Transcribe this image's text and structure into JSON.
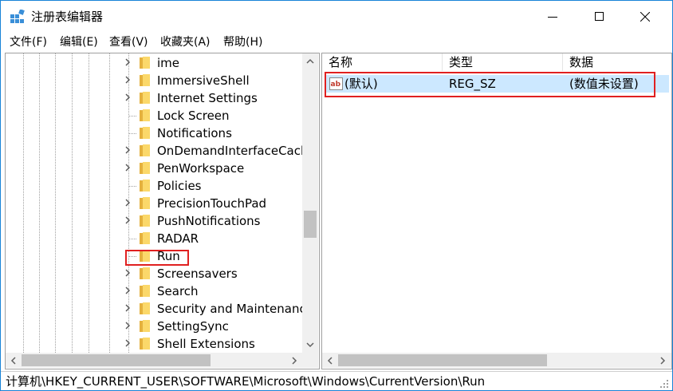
{
  "window": {
    "title": "注册表编辑器",
    "accent": "#1883d7",
    "highlight_color": "#e02020",
    "selection_color": "#cce8ff"
  },
  "menu": [
    {
      "label": "文件(F)"
    },
    {
      "label": "编辑(E)"
    },
    {
      "label": "查看(V)"
    },
    {
      "label": "收藏夹(A)"
    },
    {
      "label": "帮助(H)"
    }
  ],
  "tree": {
    "items": [
      {
        "label": "ime",
        "expandable": true,
        "icon": "folder-icon"
      },
      {
        "label": "ImmersiveShell",
        "expandable": true,
        "icon": "folder-icon"
      },
      {
        "label": "Internet Settings",
        "expandable": true,
        "icon": "folder-icon"
      },
      {
        "label": "Lock Screen",
        "expandable": false,
        "icon": "folder-icon"
      },
      {
        "label": "Notifications",
        "expandable": false,
        "icon": "folder-icon"
      },
      {
        "label": "OnDemandInterfaceCach",
        "expandable": true,
        "icon": "folder-icon"
      },
      {
        "label": "PenWorkspace",
        "expandable": true,
        "icon": "folder-icon"
      },
      {
        "label": "Policies",
        "expandable": false,
        "icon": "folder-icon"
      },
      {
        "label": "PrecisionTouchPad",
        "expandable": true,
        "icon": "folder-icon"
      },
      {
        "label": "PushNotifications",
        "expandable": true,
        "icon": "folder-icon"
      },
      {
        "label": "RADAR",
        "expandable": false,
        "icon": "folder-icon"
      },
      {
        "label": "Run",
        "expandable": false,
        "icon": "folder-icon",
        "highlighted": true
      },
      {
        "label": "Screensavers",
        "expandable": true,
        "icon": "folder-icon"
      },
      {
        "label": "Search",
        "expandable": true,
        "icon": "folder-icon"
      },
      {
        "label": "Security and Maintenance",
        "expandable": true,
        "icon": "folder-icon"
      },
      {
        "label": "SettingSync",
        "expandable": true,
        "icon": "folder-icon"
      },
      {
        "label": "Shell Extensions",
        "expandable": true,
        "icon": "folder-icon"
      }
    ]
  },
  "list": {
    "columns": {
      "name": "名称",
      "type": "类型",
      "data": "数据"
    },
    "rows": [
      {
        "icon": "string-value-icon",
        "name": "(默认)",
        "type": "REG_SZ",
        "data": "(数值未设置)"
      }
    ]
  },
  "status": {
    "path": "计算机\\HKEY_CURRENT_USER\\SOFTWARE\\Microsoft\\Windows\\CurrentVersion\\Run"
  }
}
